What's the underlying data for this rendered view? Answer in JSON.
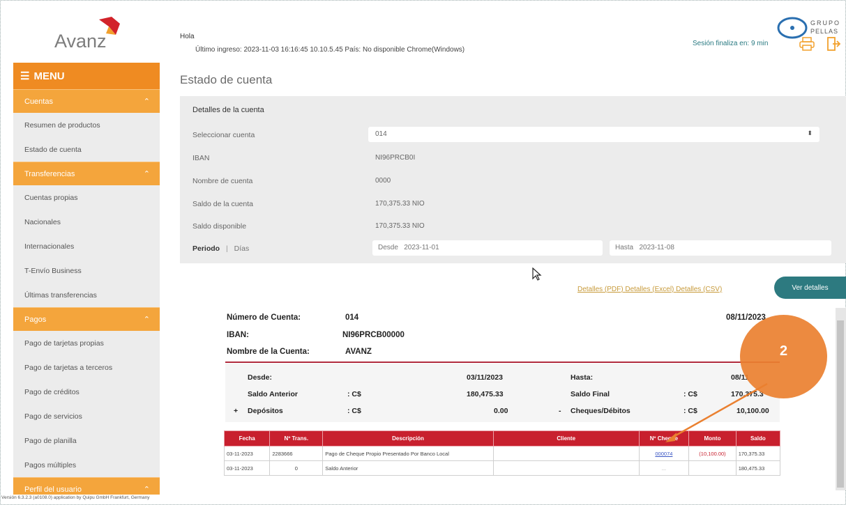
{
  "header": {
    "logo_text": "Avanz",
    "greeting": "Hola",
    "last_login": "Último ingreso: 2023-11-03 16:16:45 10.10.5.45 País: No disponible Chrome(Windows)",
    "group_logo_line1": "GRUPO",
    "group_logo_line2": "PELLAS",
    "session": "Sesión finaliza en: 9 min"
  },
  "sidebar": {
    "menu_label": "MENU",
    "sections": [
      {
        "label": "Cuentas",
        "items": [
          "Resumen de productos",
          "Estado de cuenta"
        ]
      },
      {
        "label": "Transferencias",
        "items": [
          "Cuentas propias",
          "Nacionales",
          "Internacionales",
          "T-Envío Business",
          "Últimas transferencias"
        ]
      },
      {
        "label": "Pagos",
        "items": [
          "Pago de tarjetas propias",
          "Pago de tarjetas a terceros",
          "Pago de créditos",
          "Pago de servicios",
          "Pago de planilla",
          "Pagos múltiples"
        ]
      },
      {
        "label": "Perfil del usuario",
        "items": []
      }
    ]
  },
  "page": {
    "title": "Estado de cuenta",
    "details_title": "Detalles de la cuenta",
    "rows": [
      {
        "label": "Seleccionar cuenta",
        "value": "014"
      },
      {
        "label": "IBAN",
        "value": "NI96PRCB0I"
      },
      {
        "label": "Nombre de cuenta",
        "value": "0000"
      },
      {
        "label": "Saldo de la cuenta",
        "value": "170,375.33 NIO"
      },
      {
        "label": "Saldo disponible",
        "value": "170,375.33 NIO"
      }
    ],
    "periodo": "Periodo",
    "separator": "|",
    "dias": "Días",
    "desde_label": "Desde",
    "desde_value": "2023-11-01",
    "hasta_label": "Hasta",
    "hasta_value": "2023-11-08",
    "links": [
      "Detalles (PDF)",
      "Detalles (Excel)",
      "Detalles (CSV)"
    ],
    "ver_detalles": "Ver detalles"
  },
  "statement": {
    "numero_label": "Número de Cuenta:",
    "numero_value": "014",
    "date": "08/11/2023",
    "iban_label": "IBAN:",
    "iban_value": "NI96PRCB00000",
    "nombre_label": "Nombre de la Cuenta:",
    "nombre_value": "AVANZ",
    "desde_label": "Desde:",
    "desde_value": "03/11/2023",
    "hasta_label": "Hasta:",
    "hasta_value": "08/11",
    "saldo_anterior_label": "Saldo Anterior",
    "saldo_anterior_cur": ": C$",
    "saldo_anterior_value": "180,475.33",
    "saldo_final_label": "Saldo Final",
    "saldo_final_cur": ": C$",
    "saldo_final_value": "170,375.3",
    "plus": "+",
    "depositos_label": "Depósitos",
    "depositos_cur": ": C$",
    "depositos_value": "0.00",
    "minus": "-",
    "cheques_label": "Cheques/Débitos",
    "cheques_cur": ": C$",
    "cheques_value": "10,100.00",
    "columns": [
      "Fecha",
      "Nº Trans.",
      "Descripción",
      "Cliente",
      "Nº Cheque",
      "Monto",
      "Saldo"
    ],
    "rows": [
      [
        "03-11-2023",
        "2283666",
        "Pago de Cheque Propio Presentado Por Banco Local",
        "",
        "000074",
        "(10,100.00)",
        "170,375.33"
      ],
      [
        "03-11-2023",
        "0",
        "Saldo Anterior",
        "",
        "...",
        "",
        "180,475.33"
      ]
    ]
  },
  "annotation": {
    "label": "2"
  },
  "footer": "Versión 6.3.2.3 (a0108.0)  application by Quipu GmbH Frankfurt, Germany",
  "colors": {
    "orange": "#ef8b22",
    "teal": "#2d7a80",
    "red": "#c8202e"
  }
}
